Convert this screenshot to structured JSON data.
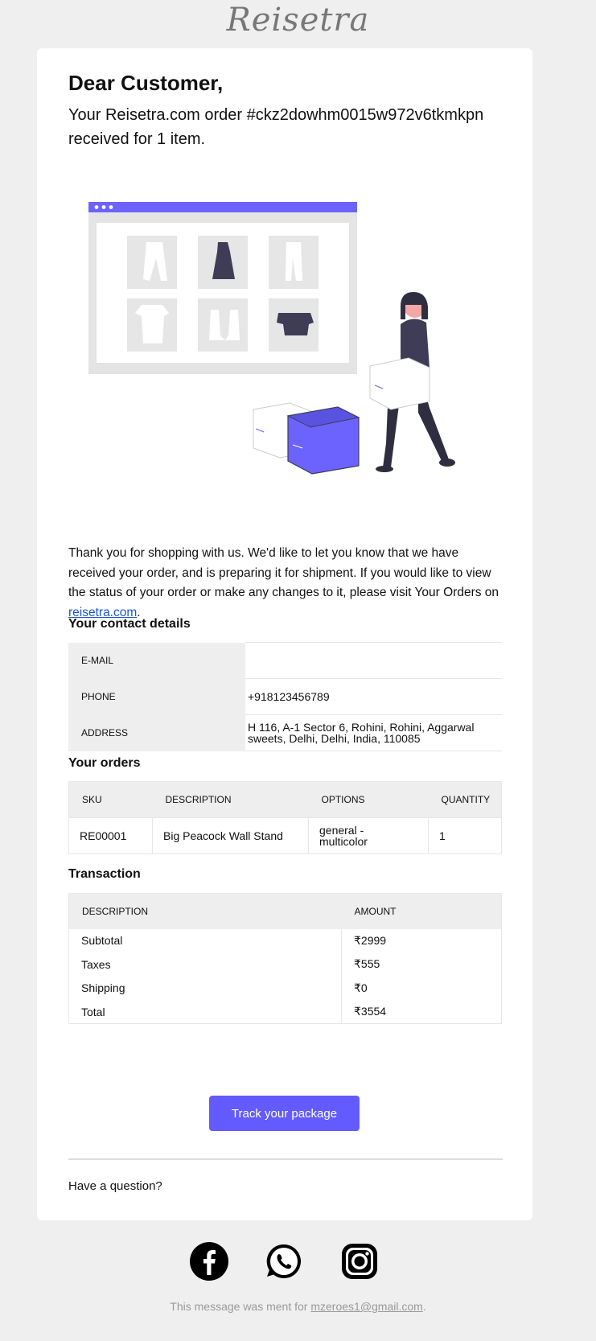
{
  "brand": {
    "logo_text": "Reisetra"
  },
  "header": {
    "greeting": "Dear Customer,",
    "intro": "Your Reisetra.com order #ckz2dowhm0015w972v6tkmkpn received for 1 item."
  },
  "message": {
    "body": "Thank you for shopping with us. We'd like to let you know that we have received your order, and is preparing it for shipment. If you would like to view the status of your order or make any changes to it, please visit Your Orders on ",
    "link_text": "reisetra.com",
    "suffix": "."
  },
  "contact": {
    "title": "Your contact details",
    "rows": [
      {
        "label": "E-MAIL",
        "value": ""
      },
      {
        "label": "PHONE",
        "value": "+918123456789"
      },
      {
        "label": "ADDRESS",
        "value": "H 116, A-1 Sector 6, Rohini, Rohini, Aggarwal sweets, Delhi, Delhi, India, 110085"
      }
    ]
  },
  "orders": {
    "title": "Your orders",
    "headers": [
      "SKU",
      "DESCRIPTION",
      "OPTIONS",
      "QUANTITY"
    ],
    "rows": [
      [
        "RE00001",
        "Big Peacock Wall Stand",
        "general - multicolor",
        "1"
      ]
    ]
  },
  "transaction": {
    "title": "Transaction",
    "headers": [
      "DESCRIPTION",
      "AMOUNT"
    ],
    "rows": [
      [
        "Subtotal",
        "₹2999"
      ],
      [
        "Taxes",
        "₹555"
      ],
      [
        "Shipping",
        "₹0"
      ],
      [
        "Total",
        "₹3554"
      ]
    ]
  },
  "cta": {
    "track_label": "Track your package"
  },
  "question": "Have a question?",
  "footer": {
    "prefix": "This message was ment for ",
    "email": "mzeroes1@gmail.com",
    "suffix": "."
  },
  "icons": [
    "facebook-icon",
    "whatsapp-icon",
    "instagram-icon"
  ],
  "colors": {
    "accent": "#635bff",
    "link": "#1a55d6",
    "page_bg": "#efefef"
  }
}
